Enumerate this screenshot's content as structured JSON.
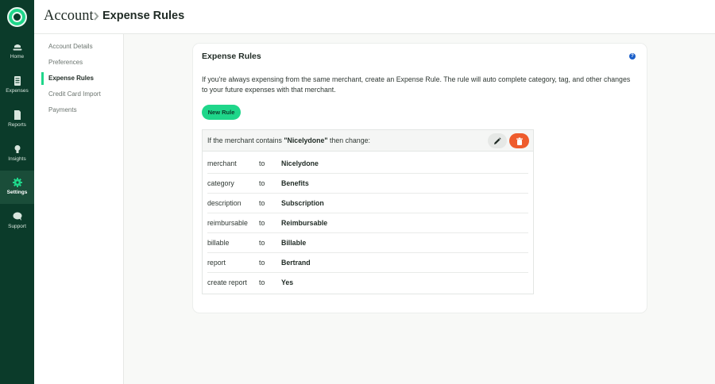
{
  "rail": {
    "items": [
      {
        "label": "Home",
        "icon": "home-icon"
      },
      {
        "label": "Expenses",
        "icon": "receipt-icon"
      },
      {
        "label": "Reports",
        "icon": "document-icon"
      },
      {
        "label": "Insights",
        "icon": "lightbulb-icon"
      },
      {
        "label": "Settings",
        "icon": "gear-icon",
        "active": true
      },
      {
        "label": "Support",
        "icon": "chat-bubble-icon"
      }
    ]
  },
  "header": {
    "breadcrumb_root": "Account",
    "breadcrumb_page": "Expense Rules"
  },
  "subnav": {
    "items": [
      {
        "label": "Account Details"
      },
      {
        "label": "Preferences"
      },
      {
        "label": "Expense Rules",
        "active": true
      },
      {
        "label": "Credit Card Import"
      },
      {
        "label": "Payments"
      }
    ]
  },
  "card": {
    "title": "Expense Rules",
    "help_glyph": "?",
    "description": "If you're always expensing from the same merchant, create an Expense Rule. The rule will auto complete category, tag, and other changes to your future expenses with that merchant.",
    "new_rule_label": "New Rule"
  },
  "rule": {
    "prefix": "If the merchant contains ",
    "merchant": "\"Nicelydone\"",
    "suffix": " then change:",
    "rows": [
      {
        "field": "merchant",
        "to": "to",
        "value": "Nicelydone"
      },
      {
        "field": "category",
        "to": "to",
        "value": "Benefits"
      },
      {
        "field": "description",
        "to": "to",
        "value": "Subscription"
      },
      {
        "field": "reimbursable",
        "to": "to",
        "value": "Reimbursable"
      },
      {
        "field": "billable",
        "to": "to",
        "value": "Billable"
      },
      {
        "field": "report",
        "to": "to",
        "value": "Bertrand"
      },
      {
        "field": "create report",
        "to": "to",
        "value": "Yes"
      }
    ]
  },
  "colors": {
    "rail_bg": "#0b3b2a",
    "accent_green": "#1fd68a",
    "delete_orange": "#ee5b2c",
    "help_blue": "#1b5fc9"
  }
}
